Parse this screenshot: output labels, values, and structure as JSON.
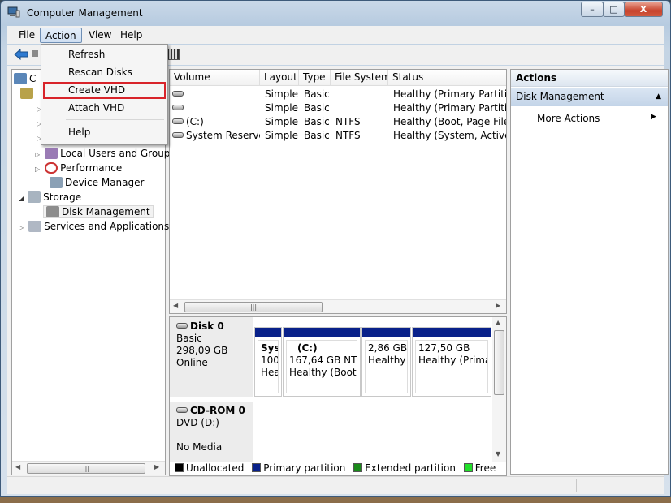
{
  "window": {
    "title": "Computer Management",
    "minimize_label": "–",
    "maximize_label": "□",
    "close_label": "X"
  },
  "menubar": {
    "items": [
      "File",
      "Action",
      "View",
      "Help"
    ]
  },
  "action_menu": {
    "items": [
      {
        "label": "Refresh"
      },
      {
        "label": "Rescan Disks"
      },
      {
        "label": "Create VHD",
        "highlighted": true,
        "highlight_color": "#d8232a"
      },
      {
        "label": "Attach VHD"
      },
      {
        "label": "Help"
      }
    ]
  },
  "tree": {
    "root_label": "C",
    "items": [
      {
        "label": "Local Users and Groups"
      },
      {
        "label": "Performance"
      },
      {
        "label": "Device Manager"
      },
      {
        "label": "Storage"
      },
      {
        "label": "Disk Management"
      },
      {
        "label": "Services and Applications"
      }
    ],
    "scroll_thumb_label": "|||"
  },
  "volumes": {
    "headers": [
      "Volume",
      "Layout",
      "Type",
      "File System",
      "Status"
    ],
    "rows": [
      {
        "volume": "",
        "layout": "Simple",
        "type": "Basic",
        "fs": "",
        "status": "Healthy (Primary Partition)"
      },
      {
        "volume": "",
        "layout": "Simple",
        "type": "Basic",
        "fs": "",
        "status": "Healthy (Primary Partition)"
      },
      {
        "volume": "(C:)",
        "layout": "Simple",
        "type": "Basic",
        "fs": "NTFS",
        "status": "Healthy (Boot, Page File, C"
      },
      {
        "volume": "System Reserved",
        "layout": "Simple",
        "type": "Basic",
        "fs": "NTFS",
        "status": "Healthy (System, Active, P"
      }
    ],
    "scroll_thumb_label": "|||"
  },
  "disks": [
    {
      "name": "Disk 0",
      "kind": "Basic",
      "size": "298,09 GB",
      "state": "Online",
      "partitions": [
        {
          "line1": "Syst",
          "line2": "100",
          "line3": "Hea"
        },
        {
          "line1": "(C:)",
          "line2": "167,64 GB NTFS",
          "line3": "Healthy (Boot,"
        },
        {
          "line1": "",
          "line2": "2,86 GB",
          "line3": "Healthy ("
        },
        {
          "line1": "",
          "line2": "127,50 GB",
          "line3": "Healthy (Primai"
        }
      ]
    },
    {
      "name": "CD-ROM 0",
      "kind": "DVD (D:)",
      "state": "No Media"
    }
  ],
  "legend": [
    {
      "label": "Unallocated",
      "color": "#000000"
    },
    {
      "label": "Primary partition",
      "color": "#09218a"
    },
    {
      "label": "Extended partition",
      "color": "#1a8a1a"
    },
    {
      "label": "Free space",
      "color": "#22e02a"
    }
  ],
  "actions_pane": {
    "header": "Actions",
    "section": "Disk Management",
    "more": "More Actions"
  }
}
